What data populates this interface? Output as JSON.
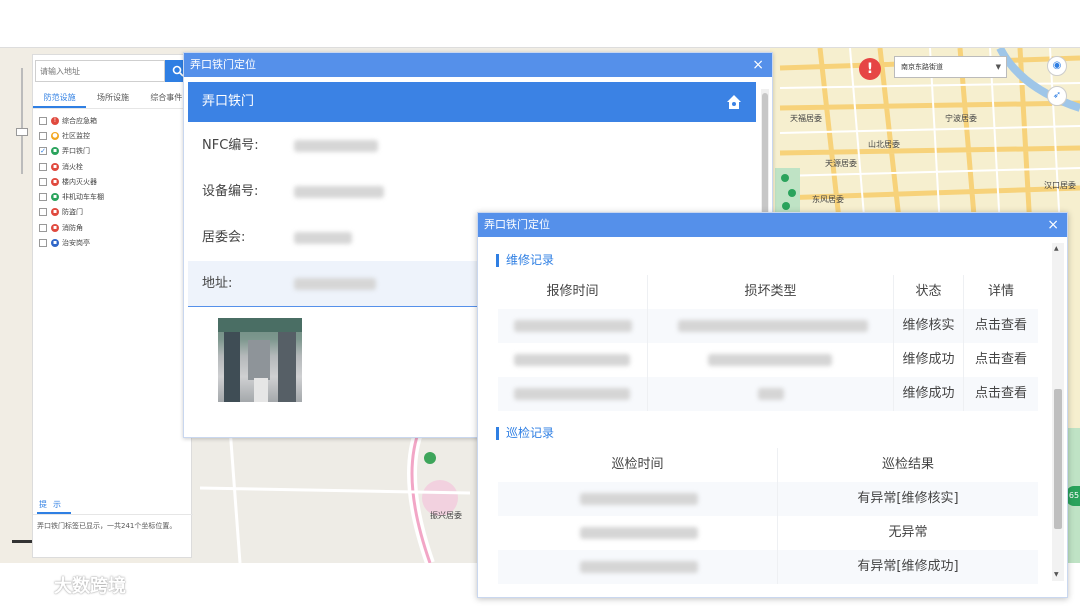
{
  "colors": {
    "accent": "#2f7fe3",
    "dialog_title_bar": "#5590ea",
    "dialog_header": "#3b82e4",
    "alert": "#e64545"
  },
  "left_panel": {
    "search_placeholder": "请输入地址",
    "tabs": [
      {
        "label": "防范设施",
        "active": true
      },
      {
        "label": "场所设施",
        "active": false
      },
      {
        "label": "综合事件",
        "active": false
      }
    ],
    "layers": [
      {
        "label": "综合应急箱",
        "checked": false,
        "color": "#e0493e",
        "icon": "emergency-icon"
      },
      {
        "label": "社区监控",
        "checked": false,
        "color": "#f2a61f",
        "icon": "camera-icon"
      },
      {
        "label": "弄口铁门",
        "checked": true,
        "color": "#2aa35c",
        "icon": "gate-icon"
      },
      {
        "label": "消火栓",
        "checked": false,
        "color": "#e0493e",
        "icon": "hydrant-icon"
      },
      {
        "label": "楼内灭火器",
        "checked": false,
        "color": "#e0493e",
        "icon": "extinguisher-icon"
      },
      {
        "label": "非机动车车棚",
        "checked": false,
        "color": "#2aa35c",
        "icon": "bike-shed-icon"
      },
      {
        "label": "防盗门",
        "checked": false,
        "color": "#e0493e",
        "icon": "door-icon"
      },
      {
        "label": "消防角",
        "checked": false,
        "color": "#e0493e",
        "icon": "fire-corner-icon"
      },
      {
        "label": "治安岗亭",
        "checked": false,
        "color": "#2f66c8",
        "icon": "police-booth-icon"
      }
    ],
    "hint_tab": "提示",
    "hint_text": "弄口铁门标签已显示，一共241个坐标位置。"
  },
  "map": {
    "street_select": "南京东路街道",
    "labels": [
      "天福居委",
      "宁波居委",
      "山北居委",
      "天源居委",
      "东风居委",
      "汉口居委",
      "振兴居委"
    ],
    "badge": "65"
  },
  "dialog1": {
    "title": "弄口铁门定位",
    "close": "×",
    "header": "弄口铁门",
    "fields": [
      {
        "label": "NFC编号:"
      },
      {
        "label": "设备编号:"
      },
      {
        "label": "居委会:"
      },
      {
        "label": "地址:"
      }
    ]
  },
  "dialog2": {
    "title": "弄口铁门定位",
    "close": "×",
    "repair": {
      "section_title": "维修记录",
      "headers": [
        "报修时间",
        "损坏类型",
        "状态",
        "详情"
      ],
      "rows": [
        {
          "status": "维修核实",
          "detail": "点击查看"
        },
        {
          "status": "维修成功",
          "detail": "点击查看"
        },
        {
          "status": "维修成功",
          "detail": "点击查看"
        }
      ]
    },
    "inspection": {
      "section_title": "巡检记录",
      "headers": [
        "巡检时间",
        "巡检结果"
      ],
      "rows": [
        {
          "result": "有异常[维修核实]"
        },
        {
          "result": "无异常"
        },
        {
          "result": "有异常[维修成功]"
        }
      ]
    }
  },
  "watermark": "大数跨境"
}
